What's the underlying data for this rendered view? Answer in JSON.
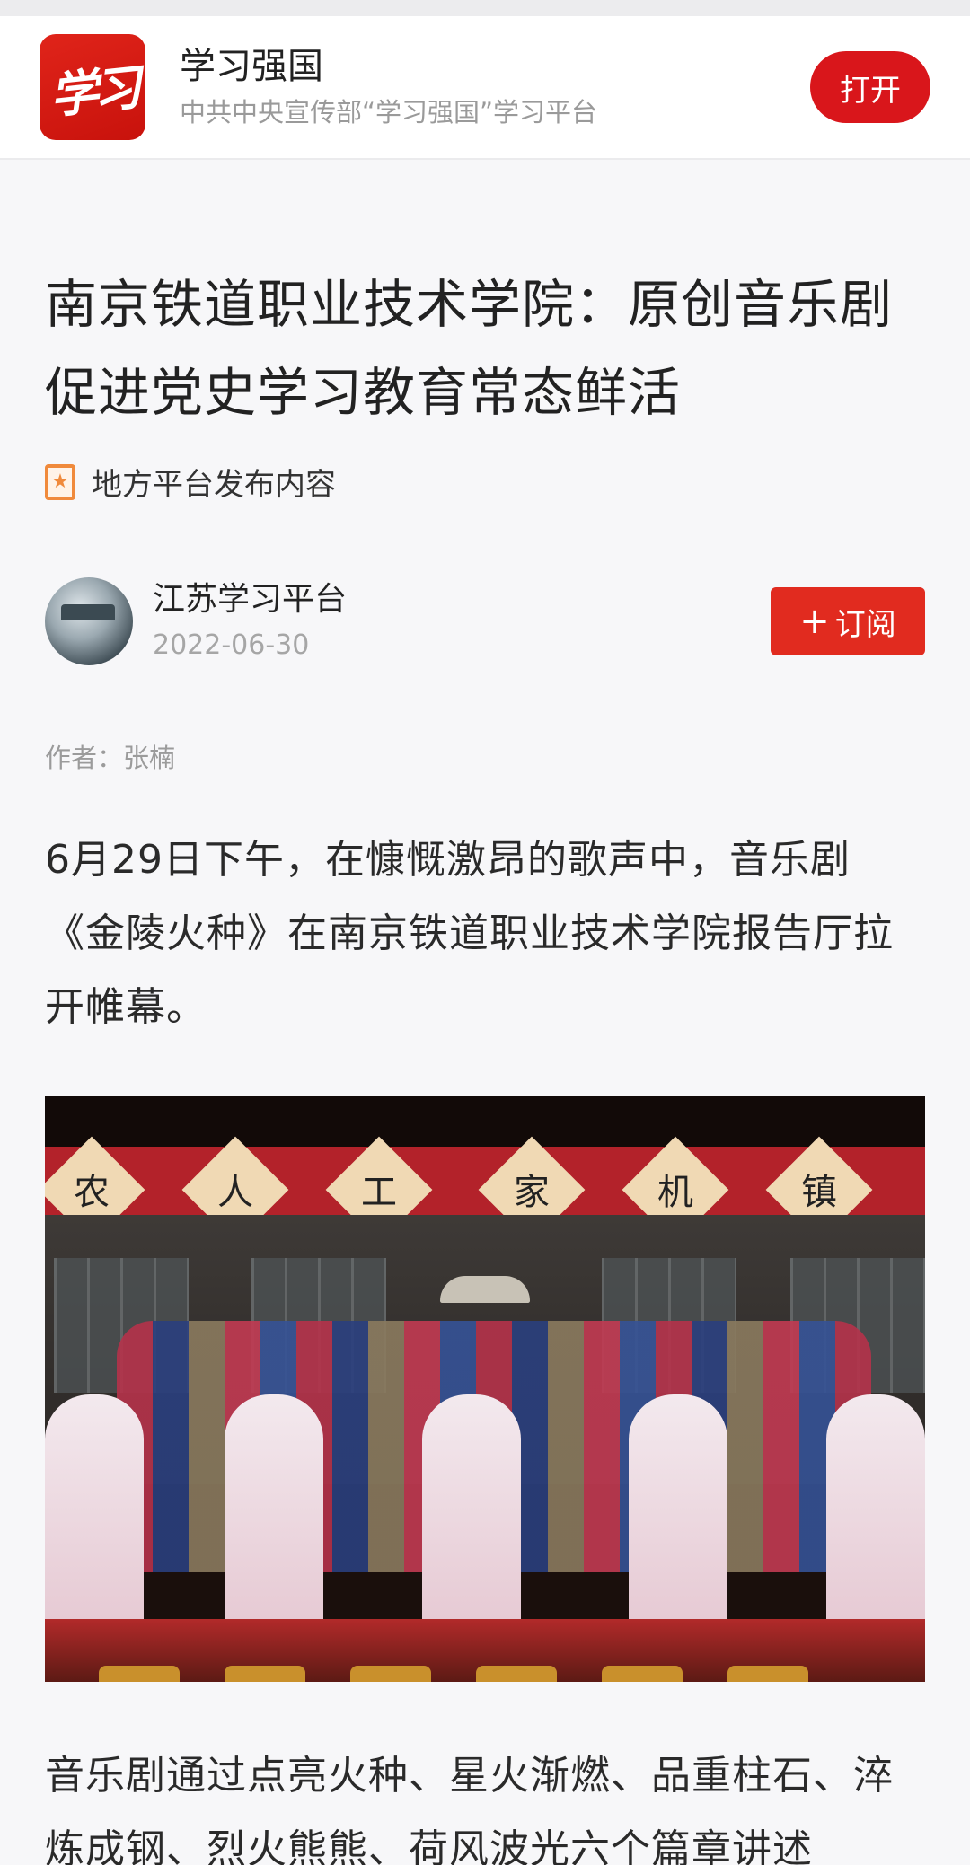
{
  "app_banner": {
    "logo_text": "学习",
    "name": "学习强国",
    "description": "中共中央宣传部“学习强国”学习平台",
    "open_label": "打开"
  },
  "article": {
    "title": "南京铁道职业技术学院：原创音乐剧促进党史学习教育常态鲜活",
    "source_tag": "地方平台发布内容",
    "author": {
      "name": "江苏学习平台",
      "date": "2022-06-30",
      "subscribe_label": "订阅",
      "subscribe_icon": "plus-icon"
    },
    "byline": "作者：张楠",
    "paragraph_1": "6月29日下午，在慷慨激昂的歌声中，音乐剧《金陵火种》在南京铁道职业技术学院报告厅拉开帷幕。",
    "photo": {
      "banner_chars": [
        "农",
        "人",
        "工",
        "家",
        "机",
        "镇"
      ]
    },
    "paragraph_2": "音乐剧通过点亮火种、星火渐燃、品重柱石、淬炼成钢、烈火熊熊、荷风波光六个篇章讲述"
  },
  "colors": {
    "brand_red": "#d9161b",
    "subscribe_red": "#e12b1f",
    "tag_orange": "#f08a3c"
  }
}
